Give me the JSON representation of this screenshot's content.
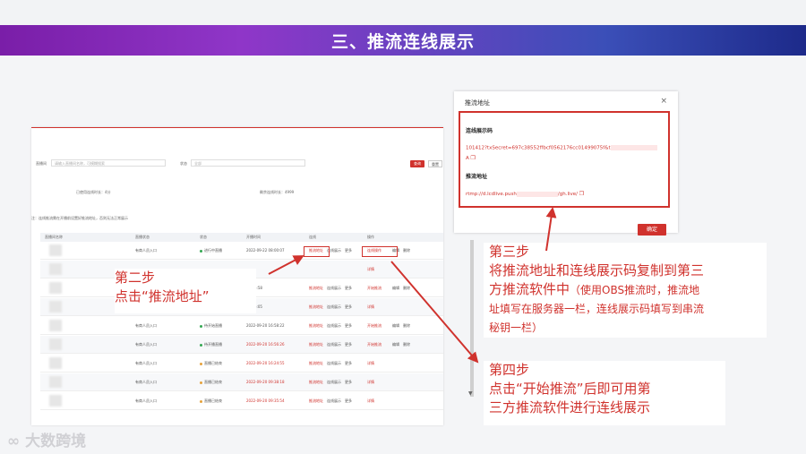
{
  "banner": {
    "title": "三、推流连线展示"
  },
  "app": {
    "filter_label_1": "直播间",
    "filter_placeholder_1": "请输入直播间名称，可模糊搜索",
    "filter_label_2": "状态",
    "filter_placeholder_2": "全部",
    "search_button": "查询",
    "reset_button": "重置",
    "stat_1": "已使用连线时长：4分",
    "stat_2": "剩余连线时长：4999",
    "notice": "注：连线推流需在开播前设置好推流地址，否则无法正常展示",
    "columns": [
      "直播间名称",
      "直播状态",
      "状态",
      "开播时间",
      "连线",
      "操作"
    ],
    "rows": [
      {
        "name": "有商人员入口",
        "status": "进行中直播",
        "time": "2022-09-22 08:00:07",
        "link": "推流地址",
        "link2": "连线展示",
        "more": "更多",
        "ops": "连线操作",
        "ops2": "编辑",
        "ops3": "删除"
      },
      {
        "name": "",
        "status": "",
        "time": "",
        "link": "",
        "link2": "",
        "more": "",
        "ops": "详情",
        "ops2": "",
        "ops3": ""
      },
      {
        "name": "",
        "status": "",
        "time": "11:55:58",
        "link": "推流地址",
        "link2": "连线展示",
        "more": "更多",
        "ops": "开始推流",
        "ops2": "编辑",
        "ops3": "删除"
      },
      {
        "name": "有商人员入口",
        "status": "",
        "time": "11:55:05",
        "link": "推流地址",
        "link2": "连线展示",
        "more": "更多",
        "ops": "详情",
        "ops2": "",
        "ops3": ""
      },
      {
        "name": "有商人员入口",
        "status": "待开始直播",
        "time": "2022-09-20 16:58:22",
        "link": "推流地址",
        "link2": "连线展示",
        "more": "更多",
        "ops": "开始推流",
        "ops2": "编辑",
        "ops3": "删除"
      },
      {
        "name": "有商人员入口",
        "status": "待开播直播",
        "time": "2022-09-20 16:56:26",
        "link": "推流地址",
        "link2": "连线展示",
        "more": "更多",
        "ops": "开始推流",
        "ops2": "编辑",
        "ops3": "删除"
      },
      {
        "name": "有商人员入口",
        "status": "直播已结束",
        "time": "2022-09-20 16:24:55",
        "link": "推流地址",
        "link2": "连线展示",
        "more": "更多",
        "ops": "详情",
        "ops2": "",
        "ops3": ""
      },
      {
        "name": "有商人员入口",
        "status": "直播已结束",
        "time": "2022-09-20 09:38:18",
        "link": "推流地址",
        "link2": "连线展示",
        "more": "更多",
        "ops": "详情",
        "ops2": "",
        "ops3": ""
      },
      {
        "name": "有商人员入口",
        "status": "直播已结束",
        "time": "2022-09-20 09:35:54",
        "link": "推流地址",
        "link2": "连线展示",
        "more": "更多",
        "ops": "详情",
        "ops2": "",
        "ops3": ""
      }
    ]
  },
  "dialog": {
    "title": "推流地址",
    "close": "×",
    "code_heading": "连线展示码",
    "code_value": "101412?txSecret=697c38552ffbcf0562176cc01499075f&t",
    "code_value_end": "A",
    "addr_heading": "推流地址",
    "addr_value": "rtmp://d.lcdlive.push",
    "addr_value_end": "/gh.live/",
    "confirm": "确定"
  },
  "captions": {
    "step2_title": "第二步",
    "step2_text": "点击“推流地址”",
    "step3_title": "第三步",
    "step3_line1": "将推流地址和连线展示码复制到第三",
    "step3_line2": "方推流软件中",
    "step3_note1": "（使用OBS推流时，推流地",
    "step3_note2": "址填写在服务器一栏，连线展示码填写到串流",
    "step3_note3": "秘钥一栏）",
    "step4_title": "第四步",
    "step4_line1": "点击“开始推流”后即可用第",
    "step4_line2": "三方推流软件进行连线展示"
  },
  "logo": {
    "text": "大数跨境"
  },
  "colors": {
    "accent": "#d0322d",
    "banner_start": "#7a1ea8",
    "banner_end": "#1d2a8a"
  }
}
